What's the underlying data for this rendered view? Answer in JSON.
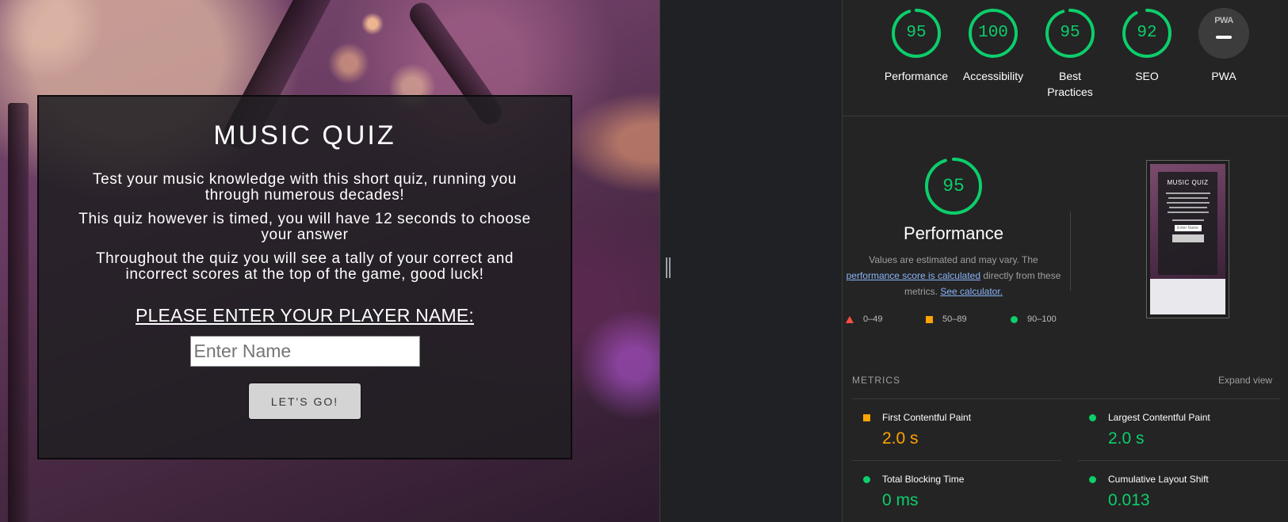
{
  "quiz": {
    "title": "MUSIC QUIZ",
    "intro_1": "Test your music knowledge with this short quiz, running you through numerous decades!",
    "intro_2": "This quiz however is timed, you will have 12 seconds to choose your answer",
    "intro_3": "Throughout the quiz you will see a tally of your correct and incorrect scores at the top of the game, good luck!",
    "name_label": "PLEASE ENTER YOUR PLAYER NAME:",
    "name_placeholder": "Enter Name",
    "name_value": "",
    "go_label": "LET'S GO!"
  },
  "lighthouse": {
    "categories": [
      {
        "label": "Performance",
        "score": 95
      },
      {
        "label": "Accessibility",
        "score": 100
      },
      {
        "label": "Best Practices",
        "score": 95
      },
      {
        "label": "SEO",
        "score": 92
      }
    ],
    "pwa": {
      "label": "PWA",
      "badge_text": "PWA"
    },
    "focus": {
      "score": 95,
      "title": "Performance",
      "desc_prefix": "Values are estimated and may vary. The",
      "desc_link": "performance score is calculated",
      "desc_middle": "directly from these metrics.",
      "calc_link": "See calculator."
    },
    "legend": {
      "fail": "0–49",
      "average": "50–89",
      "pass": "90–100"
    },
    "thumbnail": {
      "title": "MUSIC QUIZ",
      "input_placeholder": "Enter Name"
    },
    "metrics_heading": "METRICS",
    "expand_label": "Expand view",
    "metrics": [
      {
        "name": "First Contentful Paint",
        "value": "2.0 s",
        "rating": "average"
      },
      {
        "name": "Largest Contentful Paint",
        "value": "2.0 s",
        "rating": "pass"
      },
      {
        "name": "Total Blocking Time",
        "value": "0 ms",
        "rating": "pass"
      },
      {
        "name": "Cumulative Layout Shift",
        "value": "0.013",
        "rating": "pass"
      }
    ]
  },
  "colors": {
    "pass": "#0cce6b",
    "average": "#ffa400",
    "fail": "#ff4e42",
    "link": "#8ab4f8"
  }
}
